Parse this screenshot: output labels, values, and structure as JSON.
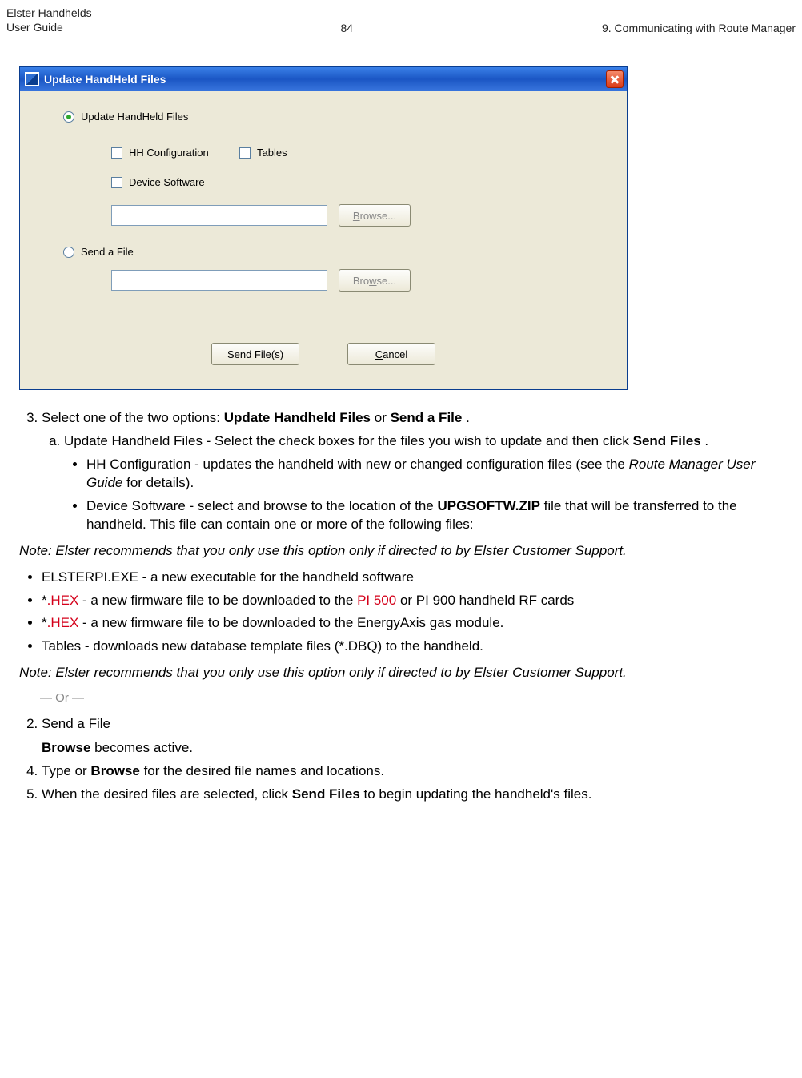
{
  "header": {
    "left_line1": "Elster Handhelds",
    "left_line2": "User Guide",
    "page_number": "84",
    "right": "9. Communicating with Route Manager"
  },
  "dialog": {
    "title": "Update HandHeld Files",
    "opt_update": "Update HandHeld Files",
    "chk_hh_config": "HH Configuration",
    "chk_tables": "Tables",
    "chk_device_sw": "Device Software",
    "browse1_label_pre": "B",
    "browse1_label_post": "rowse...",
    "opt_send": "Send a File",
    "browse2_label_pre": "Bro",
    "browse2_label_underline": "w",
    "browse2_label_post": "se...",
    "btn_send": "Send File(s)",
    "btn_cancel_pre": "",
    "btn_cancel_underline": "C",
    "btn_cancel_post": "ancel"
  },
  "body": {
    "step3_intro_a": "Select one of the two options: ",
    "step3_b1": "Update Handheld Files",
    "step3_mid": " or ",
    "step3_b2": "Send a File",
    "step3_end": ".",
    "step3a_text_a": "Update Handheld Files - Select the check boxes for the files you wish to update and then click ",
    "step3a_b": "Send Files",
    "step3a_end": ".",
    "bullet_hhconfig_a": "HH Configuration - updates the handheld with new or changed configuration files (see the ",
    "bullet_hhconfig_i": "Route Manager User Guide",
    "bullet_hhconfig_b": " for details).",
    "bullet_devsw_a": "Device Software - select and browse to the location of the ",
    "bullet_devsw_b": "UPGSOFTW.ZIP",
    "bullet_devsw_c": " file that will be transferred to the handheld. This file can contain one or more of the following files:",
    "note1_label": "Note:",
    "note1_text": " Elster recommends that you only use this option only if directed to by Elster Customer Support.",
    "sub_elsterpi": "ELSTERPI.EXE - a new executable for the handheld software",
    "sub_hex1_a": "*",
    "sub_hex1_red1": ".HEX",
    "sub_hex1_mid": " - a new firmware file to be downloaded to the ",
    "sub_hex1_red2": "PI 500",
    "sub_hex1_end": " or PI 900 handheld RF cards",
    "sub_hex2_a": "*",
    "sub_hex2_red": ".HEX",
    "sub_hex2_end": " - a new firmware file to be downloaded to the EnergyAxis gas module.",
    "bullet_tables": "Tables - downloads new database template files (*.DBQ) to the handheld.",
    "note2_label": "Note:",
    "note2_text": " Elster recommends that you only use this option only if directed to by Elster Customer Support.",
    "or_sep": "— Or —",
    "step3b_text": "Send a File",
    "step3b_browse_a": "Browse",
    "step3b_browse_b": " becomes active.",
    "step4_a": "Type or ",
    "step4_b": "Browse",
    "step4_c": " for the desired file names and locations.",
    "step5_a": "When the desired files are selected, click ",
    "step5_b": "Send Files",
    "step5_c": " to begin updating the handheld's files."
  }
}
